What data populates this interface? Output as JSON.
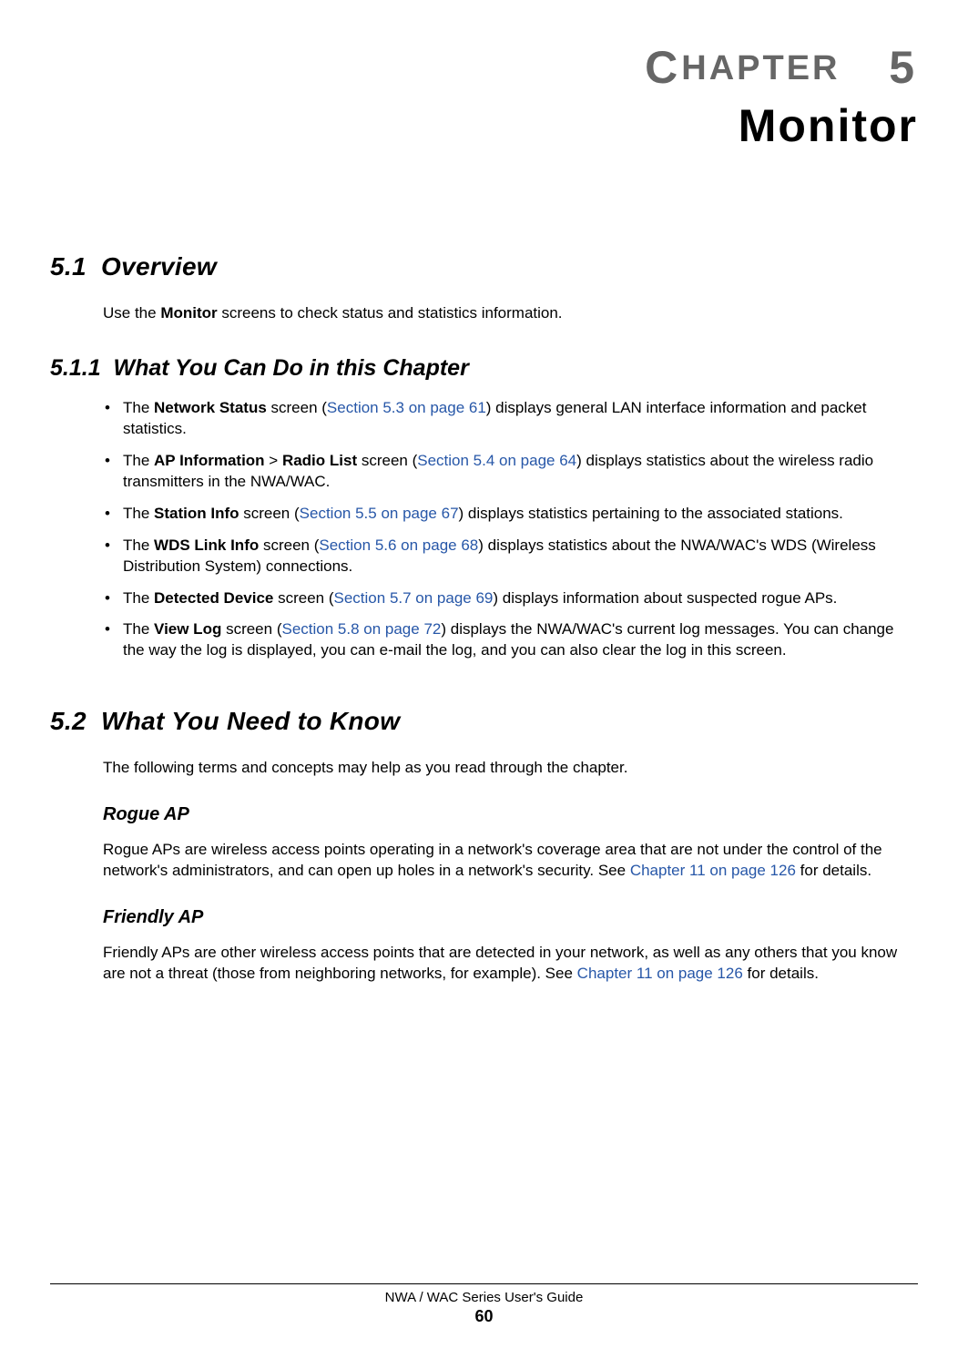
{
  "chapter": {
    "label_prefix": "C",
    "label_rest": "HAPTER",
    "number": "5",
    "title": "Monitor"
  },
  "sections": {
    "overview": {
      "num": "5.1",
      "title": "Overview",
      "intro_pre": "Use the ",
      "intro_bold": "Monitor",
      "intro_post": " screens to check status and statistics information."
    },
    "whatyoucando": {
      "num": "5.1.1",
      "title": "What You Can Do in this Chapter",
      "items": [
        {
          "pre": "The ",
          "bold1": "Network Status",
          "mid1": " screen (",
          "link": "Section 5.3 on page 61",
          "post": ") displays general LAN interface information and packet statistics."
        },
        {
          "pre": "The ",
          "bold1": "AP Information",
          "mid1": " > ",
          "bold2": "Radio List",
          "mid2": " screen (",
          "link": "Section 5.4 on page 64",
          "post": ") displays statistics about the wireless radio transmitters in the NWA/WAC."
        },
        {
          "pre": "The ",
          "bold1": "Station Info",
          "mid1": " screen (",
          "link": "Section 5.5 on page 67",
          "post": ") displays statistics pertaining to the associated stations."
        },
        {
          "pre": "The ",
          "bold1": "WDS Link Info",
          "mid1": " screen (",
          "link": "Section 5.6 on page 68",
          "post": ") displays statistics about the NWA/WAC's WDS (Wireless Distribution System) connections."
        },
        {
          "pre": "The ",
          "bold1": "Detected Device",
          "mid1": " screen (",
          "link": "Section 5.7 on page 69",
          "post": ") displays information about suspected rogue APs."
        },
        {
          "pre": "The ",
          "bold1": "View Log",
          "mid1": " screen (",
          "link": "Section 5.8 on page 72",
          "post": ") displays the NWA/WAC's current log messages. You can change the way the log is displayed, you can e-mail the log, and you can also clear the log in this screen."
        }
      ]
    },
    "needtoknow": {
      "num": "5.2",
      "title": "What You Need to Know",
      "intro": "The following terms and concepts may help as you read through the chapter.",
      "rogue": {
        "heading": "Rogue AP",
        "pre": "Rogue APs are wireless access points operating in a network's coverage area that are not under the control of the network's administrators, and can open up holes in a network's security. See ",
        "link": "Chapter 11 on page 126",
        "post": " for details."
      },
      "friendly": {
        "heading": "Friendly AP",
        "pre": "Friendly APs are other wireless access points that are detected in your network, as well as any others that you know are not a threat (those from neighboring networks, for example). See ",
        "link": "Chapter 11 on page 126",
        "post": " for details."
      }
    }
  },
  "footer": {
    "title": "NWA / WAC Series User's Guide",
    "page": "60"
  }
}
